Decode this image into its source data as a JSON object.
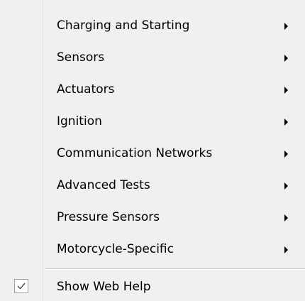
{
  "menu": {
    "items": [
      {
        "label": "Charging and Starting",
        "has_submenu": true
      },
      {
        "label": "Sensors",
        "has_submenu": true
      },
      {
        "label": "Actuators",
        "has_submenu": true
      },
      {
        "label": "Ignition",
        "has_submenu": true
      },
      {
        "label": "Communication Networks",
        "has_submenu": true
      },
      {
        "label": "Advanced Tests",
        "has_submenu": true
      },
      {
        "label": "Pressure Sensors",
        "has_submenu": true
      },
      {
        "label": "Motorcycle-Specific",
        "has_submenu": true
      }
    ],
    "web_help": {
      "label": "Show Web Help",
      "checked": true,
      "icon": "checkmark-icon"
    },
    "submenu_icon": "submenu-arrow-icon",
    "colors": {
      "background": "#f0f0f0",
      "text": "#000000"
    }
  }
}
